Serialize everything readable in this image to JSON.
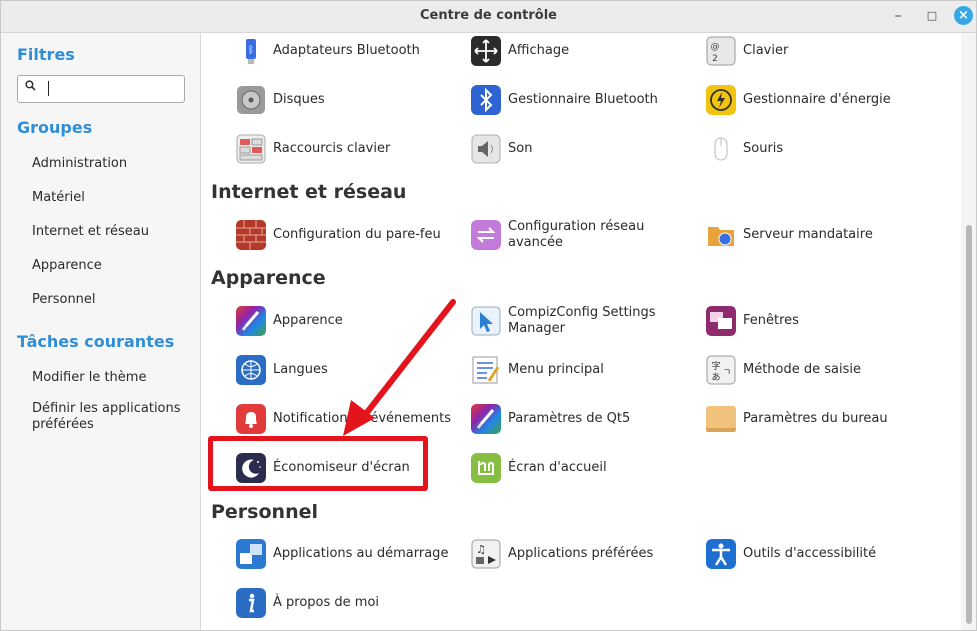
{
  "window": {
    "title": "Centre de contrôle",
    "minimize": "–",
    "maximize": "□",
    "close": "×"
  },
  "sidebar": {
    "filters_heading": "Filtres",
    "search": {
      "value": "",
      "placeholder": ""
    },
    "groups_heading": "Groupes",
    "groups": [
      "Administration",
      "Matériel",
      "Internet et réseau",
      "Apparence",
      "Personnel"
    ],
    "tasks_heading": "Tâches courantes",
    "tasks": [
      "Modifier le thème",
      "Définir les applications préférées"
    ]
  },
  "sections": {
    "materiel": {
      "items": [
        "Adaptateurs Bluetooth",
        "Affichage",
        "Clavier",
        "Disques",
        "Gestionnaire Bluetooth",
        "Gestionnaire d'énergie",
        "Raccourcis clavier",
        "Son",
        "Souris"
      ]
    },
    "internet": {
      "title": "Internet et réseau",
      "items": [
        "Configuration du pare-feu",
        "Configuration réseau avancée",
        "Serveur mandataire"
      ]
    },
    "apparence": {
      "title": "Apparence",
      "items": [
        "Apparence",
        "CompizConfig Settings Manager",
        "Fenêtres",
        "Langues",
        "Menu principal",
        "Méthode de saisie",
        "Notifications d'événements",
        "Paramètres de Qt5",
        "Paramètres du bureau",
        "Économiseur d'écran",
        "Écran d'accueil"
      ]
    },
    "personnel": {
      "title": "Personnel",
      "items": [
        "Applications au démarrage",
        "Applications préférées",
        "Outils d'accessibilité",
        "À propos de moi"
      ]
    }
  },
  "colors": {
    "accent": "#2e8fd8",
    "annotation": "#e3141b"
  }
}
